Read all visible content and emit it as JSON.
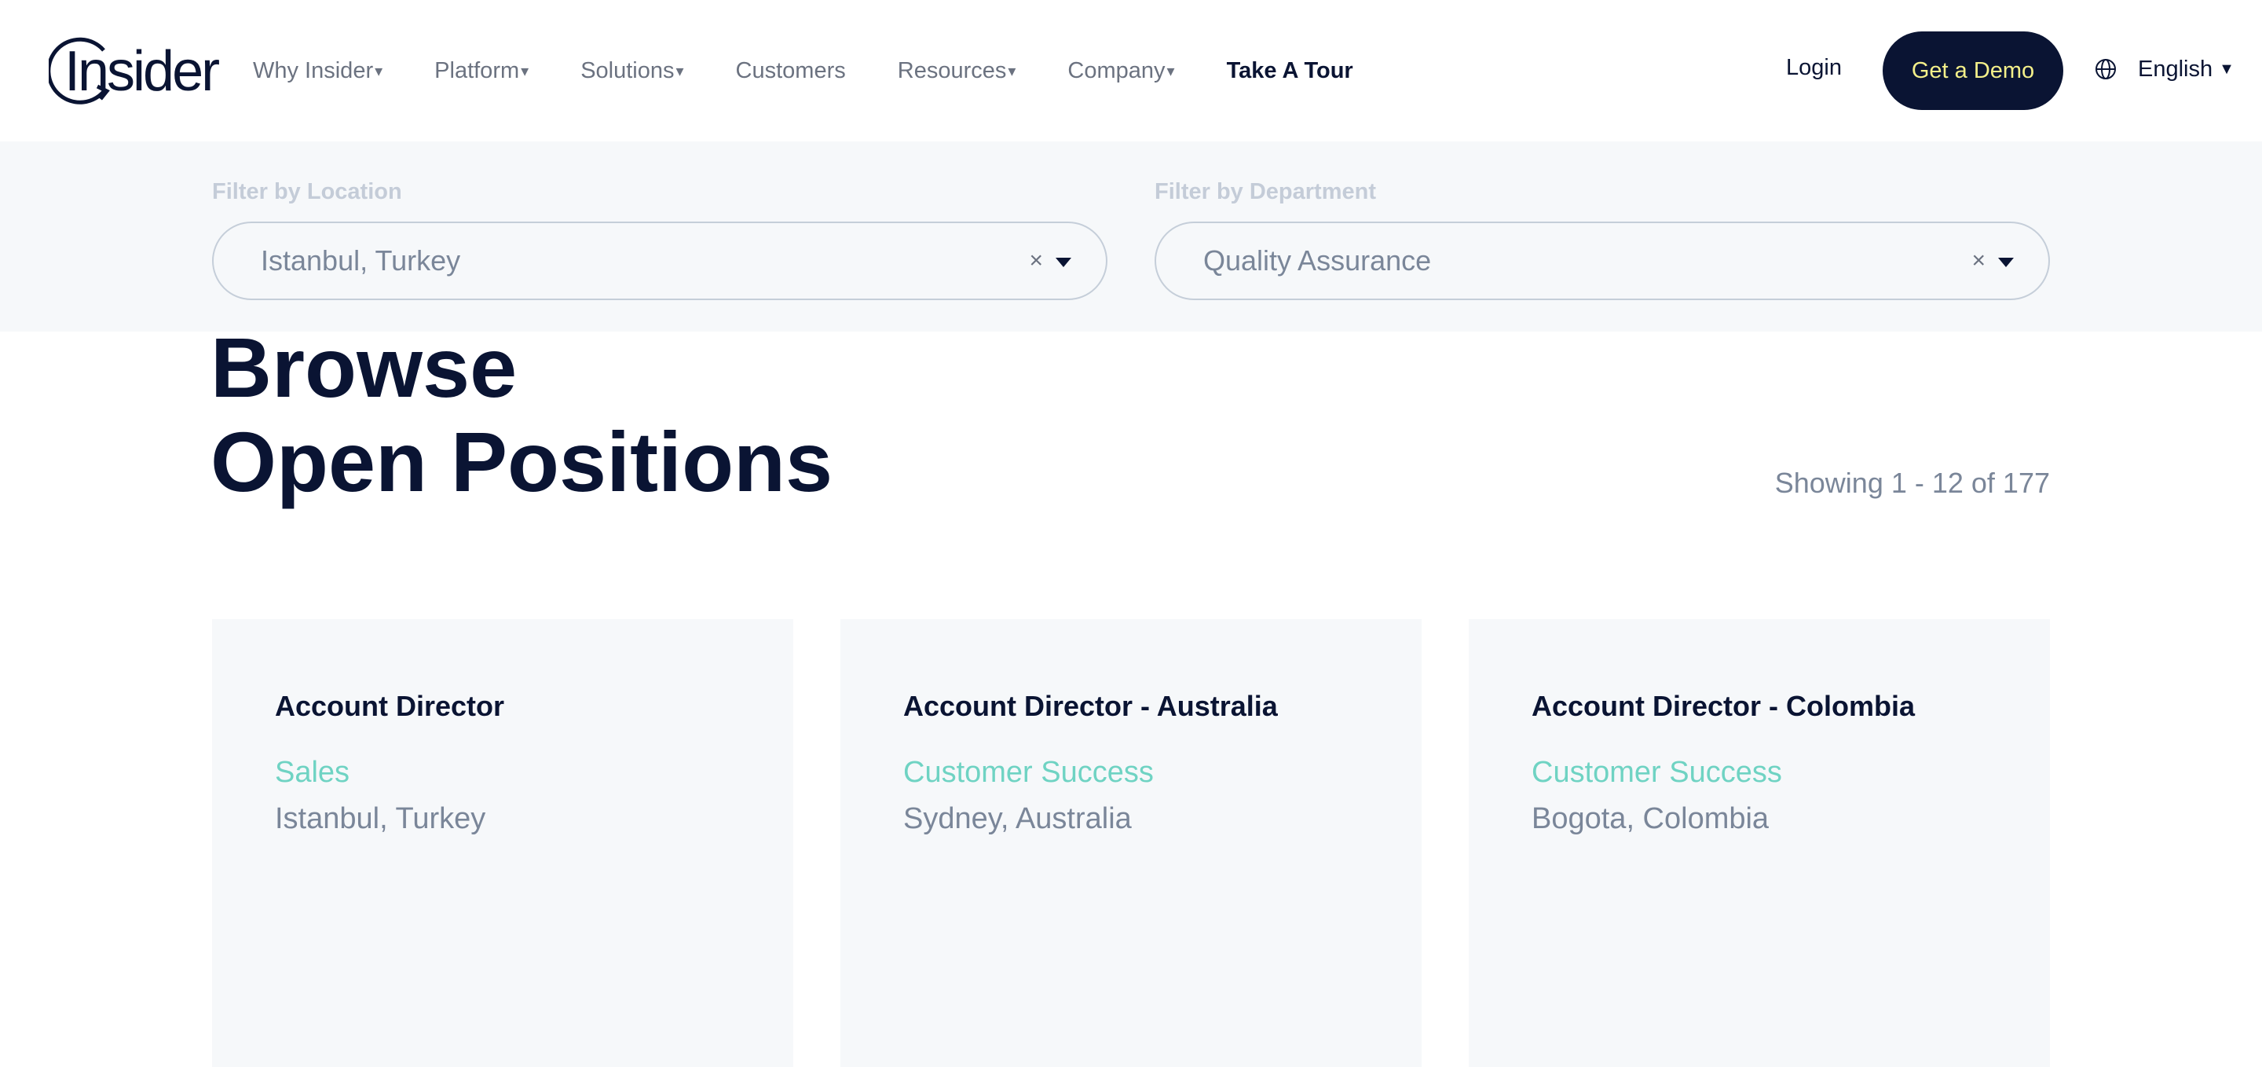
{
  "header": {
    "logo_text": "Insider",
    "nav": [
      {
        "label": "Why Insider",
        "has_caret": true
      },
      {
        "label": "Platform",
        "has_caret": true
      },
      {
        "label": "Solutions",
        "has_caret": true
      },
      {
        "label": "Customers",
        "has_caret": false
      },
      {
        "label": "Resources",
        "has_caret": true
      },
      {
        "label": "Company",
        "has_caret": true
      },
      {
        "label": "Take A Tour",
        "has_caret": false
      }
    ],
    "login_label": "Login",
    "demo_label": "Get a Demo",
    "language_label": "English",
    "caret_glyph": "▾",
    "dropdown_glyph": "▼"
  },
  "filters": {
    "location": {
      "label": "Filter by Location",
      "value": "Istanbul, Turkey",
      "clear_glyph": "×"
    },
    "department": {
      "label": "Filter by Department",
      "value": "Quality Assurance",
      "clear_glyph": "×"
    }
  },
  "title": {
    "line1": "Browse",
    "line2": "Open Positions"
  },
  "showing_text": "Showing 1 - 12 of 177",
  "positions": [
    {
      "title": "Account Director",
      "department": "Sales",
      "location": "Istanbul, Turkey"
    },
    {
      "title": "Account Director - Australia",
      "department": "Customer Success",
      "location": "Sydney, Australia"
    },
    {
      "title": "Account Director - Colombia",
      "department": "Customer Success",
      "location": "Bogota, Colombia"
    }
  ],
  "colors": {
    "navy": "#0a1433",
    "demo_text": "#f4f08a",
    "teal": "#6fd3c3",
    "muted": "#7a8699",
    "panel_bg": "#f6f8fa"
  },
  "icons": {
    "logo": "insider-logo-icon",
    "globe": "globe-icon",
    "clear": "clear-icon",
    "dropdown": "dropdown-arrow-icon"
  }
}
